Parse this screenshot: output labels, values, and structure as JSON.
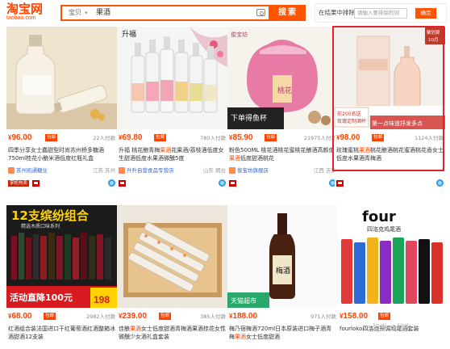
{
  "header": {
    "logo_main": "淘宝网",
    "logo_sub": "taobao.com",
    "scope": "宝贝",
    "query": "果酒",
    "search_label": "搜索",
    "filter_label": "在结果中排除",
    "filter_placeholder": "请输入要排除的词",
    "filter_button": "确定"
  },
  "products": [
    {
      "price": "96.00",
      "badge": "包邮",
      "paid": "22人付款",
      "title_pre": "四季分享女士蠢甜型时尚苏州桥多糖",
      "title_hl": "",
      "title_post": "酒750ml桂花小酿米酒低度红瓶礼盒",
      "shop": "苏州凯通糖业",
      "location": "江苏 苏州",
      "extra_badge": "掌柜热卖"
    },
    {
      "price": "69.80",
      "badge": "包邮",
      "paid": "780人付款",
      "title_pre": "升福 桃花酿青梅",
      "title_hl": "果酒",
      "title_post": "花果酒/荔枝酒低度女生甜酒低度水果酒微醺5度",
      "shop": "升升自营食品专营店",
      "location": "山东 烟台",
      "extra_badge": ""
    },
    {
      "price": "85.90",
      "badge": "包邮",
      "paid": "21975人付款",
      "title_pre": "粉色500ML 桃花酒桃花蜜桃花酿酒高颜值",
      "title_hl": "果酒",
      "title_post": "低度甜酒桃花",
      "shop": "俊宝坊旗舰店",
      "location": "江西 吉安",
      "extra_badge": ""
    },
    {
      "price": "98.00",
      "badge": "包邮",
      "paid": "1124人付款",
      "title_pre": "玫瑰蜜桃",
      "title_hl": "果酒",
      "title_post": "桃花酿酒桃花蜜酒桃花香女士低度水果酒青梅酒",
      "shop": "",
      "location": "",
      "extra_badge": ""
    },
    {
      "price": "68.00",
      "badge": "包邮",
      "paid": "2982人付款",
      "title_pre": "红酒组合装法国进口干红葡萄酒红酒整箱冰酒甜酒",
      "title_hl": "",
      "title_post": "12支装",
      "shop": "",
      "location": "",
      "extra_badge": ""
    },
    {
      "price": "239.00",
      "badge": "包邮",
      "paid": "385人付款",
      "title_pre": "佳酿",
      "title_hl": "果酒",
      "title_post": "女士低度甜酒青梅酒果酒桂花女性微醺少女酒礼盒套装",
      "shop": "",
      "location": "",
      "extra_badge": ""
    },
    {
      "price": "188.00",
      "badge": "",
      "paid": "971人付款",
      "title_pre": "梅乃宿梅酒720ml日本原装进口梅子酒青梅",
      "title_hl": "果酒",
      "title_post": "女士低度甜酒",
      "shop": "",
      "location": "",
      "extra_badge": ""
    },
    {
      "price": "158.00",
      "badge": "包邮",
      "paid": "",
      "title_pre": "fourloko四洛克",
      "title_hl": "",
      "title_post": "预调鸡尾酒套装",
      "shop": "",
      "location": "",
      "extra_badge": ""
    }
  ],
  "images": {
    "p1_text": "",
    "p2_brand": "升福",
    "p3_brand": "俊宝坊",
    "p3_label": "桃花",
    "p3_banner": "下单得鱼杯",
    "p4_corner_1": "聚划算",
    "p4_corner_2": "10月",
    "p4_tag_1": "前200名送",
    "p4_tag_2": "玫瑰定制酒杯",
    "p4_banner": "第一点味道抒发多点",
    "p5_title": "12支缤纷组合",
    "p5_sub": "精选木质口味系列",
    "p5_promo": "活动直降100元",
    "p5_price": "198",
    "p7_tag": "天猫超市",
    "p7_label": "梅酒",
    "p8_brand": "four",
    "p8_sub": "四洛克鸡尾酒"
  },
  "watermark": "知乎 @阿牛",
  "colors": {
    "accent": "#ff5500",
    "price": "#ff4400",
    "highlight_box": "#e0242e"
  }
}
